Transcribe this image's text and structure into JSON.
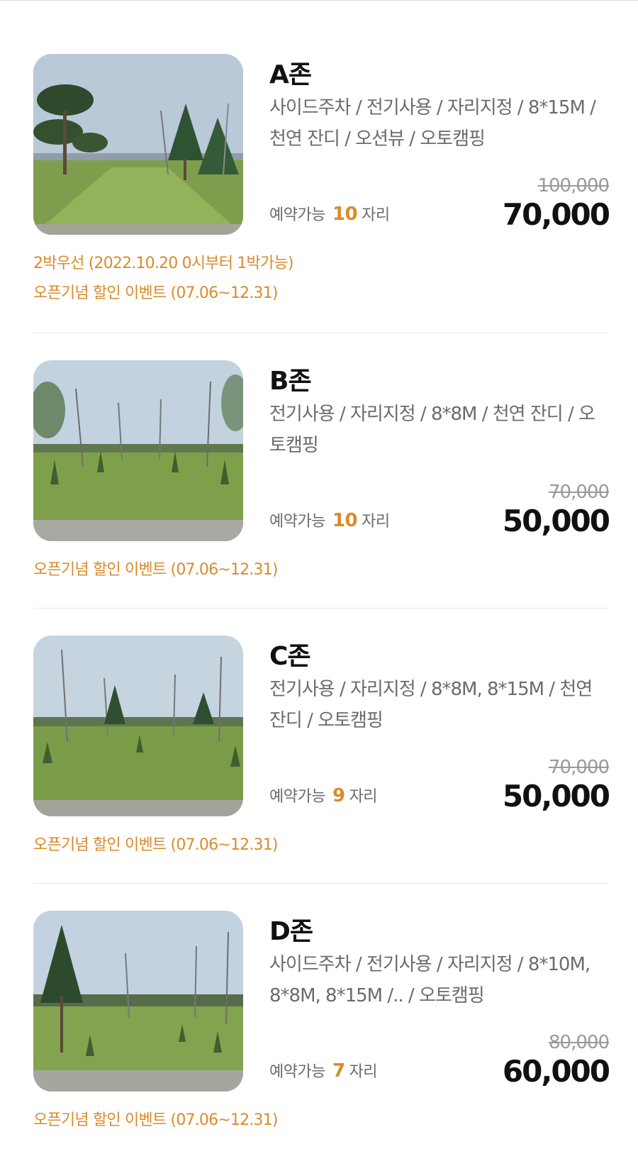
{
  "zones": [
    {
      "name": "A존",
      "features": "사이드주차 / 전기사용 / 자리지정 / 8*15M / 천연 잔디 / 오션뷰 / 오토캠핑",
      "avail_label": "예약가능",
      "avail_count": "10",
      "avail_unit": "자리",
      "original_price": "100,000",
      "price": "70,000",
      "notes": [
        "2박우선 (2022.10.20 0시부터 1박가능)",
        "오픈기념 할인 이벤트 (07.06~12.31)"
      ]
    },
    {
      "name": "B존",
      "features": "전기사용 / 자리지정 / 8*8M / 천연 잔디 / 오토캠핑",
      "avail_label": "예약가능",
      "avail_count": "10",
      "avail_unit": "자리",
      "original_price": "70,000",
      "price": "50,000",
      "notes": [
        "오픈기념 할인 이벤트 (07.06~12.31)"
      ]
    },
    {
      "name": "C존",
      "features": "전기사용 / 자리지정 / 8*8M, 8*15M / 천연 잔디 / 오토캠핑",
      "avail_label": "예약가능",
      "avail_count": "9",
      "avail_unit": "자리",
      "original_price": "70,000",
      "price": "50,000",
      "notes": [
        "오픈기념 할인 이벤트 (07.06~12.31)"
      ]
    },
    {
      "name": "D존",
      "features": "사이드주차 / 전기사용 / 자리지정 / 8*10M, 8*8M, 8*15M /.. / 오토캠핑",
      "avail_label": "예약가능",
      "avail_count": "7",
      "avail_unit": "자리",
      "original_price": "80,000",
      "price": "60,000",
      "notes": [
        "오픈기념 할인 이벤트 (07.06~12.31)"
      ]
    }
  ],
  "colors": {
    "accent": "#d98b2c",
    "muted_text": "#6b6b6b",
    "strike_text": "#9a9a9a"
  }
}
